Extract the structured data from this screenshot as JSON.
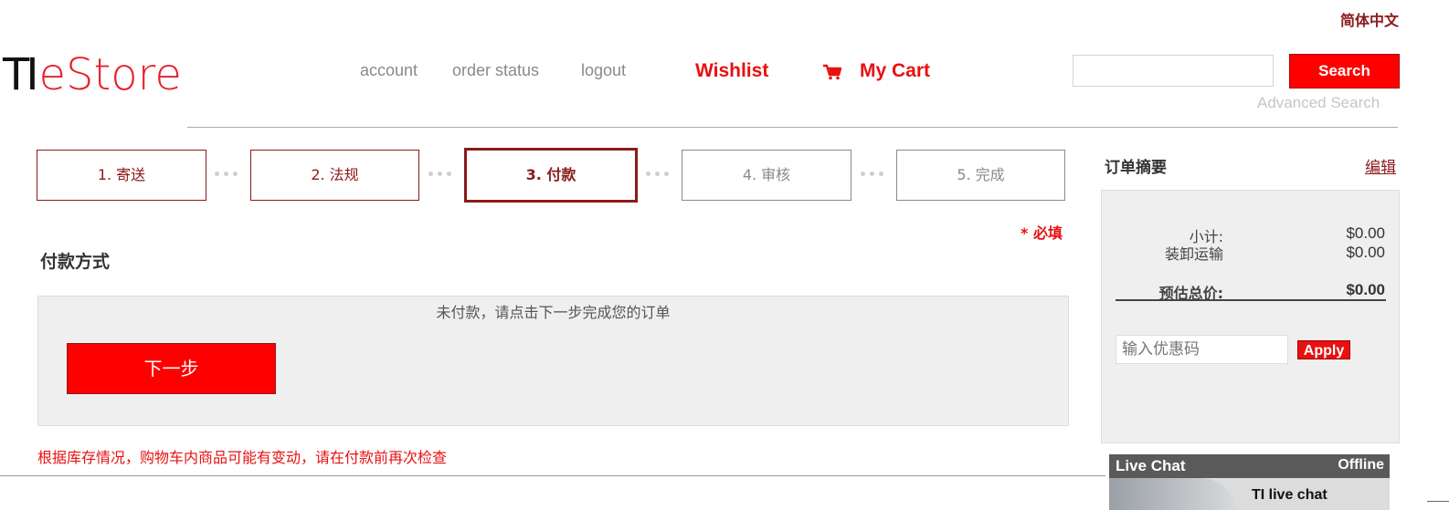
{
  "header": {
    "language": "简体中文",
    "logo": {
      "part1": "TI",
      "part2": "eStore"
    },
    "nav": {
      "account": "account",
      "order_status": "order status",
      "logout": "logout"
    },
    "wishlist": "Wishlist",
    "cart": "My Cart",
    "search": {
      "value": "",
      "button": "Search",
      "advanced": "Advanced Search"
    }
  },
  "steps": [
    {
      "label": "1. 寄送",
      "state": "done"
    },
    {
      "label": "2. 法规",
      "state": "done"
    },
    {
      "label": "3. 付款",
      "state": "active"
    },
    {
      "label": "4. 审核",
      "state": "todo"
    },
    {
      "label": "5. 完成",
      "state": "todo"
    }
  ],
  "required_note": "* 必填",
  "payment": {
    "title": "付款方式",
    "message": "未付款，请点击下一步完成您的订单",
    "next_button": "下一步",
    "stock_note": "根据库存情况，购物车内商品可能有变动，请在付款前再次检查"
  },
  "summary": {
    "title": "订单摘要",
    "edit": "编辑",
    "subtotal_label": "小计:",
    "subtotal_value": "$0.00",
    "shipping_label": "装卸运输",
    "shipping_value": "$0.00",
    "total_label": "预估总价:",
    "total_value": "$0.00",
    "coupon_placeholder": "输入优惠码",
    "apply": "Apply"
  },
  "live_chat": {
    "title": "Live Chat",
    "status": "Offline",
    "text": "TI live chat"
  },
  "colors": {
    "brand_red": "#e81010",
    "step_red": "#8b1a1a",
    "button_red": "#ff0000"
  }
}
